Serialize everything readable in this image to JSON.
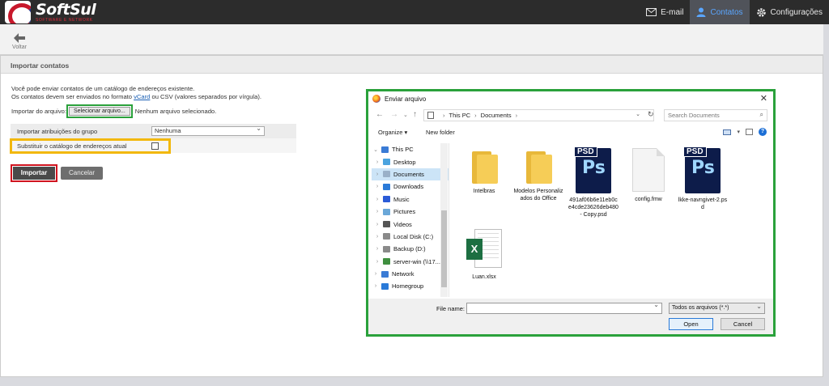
{
  "brand": {
    "name": "SoftSul",
    "tagline": "SOFTWARE E NETWORK"
  },
  "nav": {
    "items": [
      {
        "label": "E-mail",
        "icon": "envelope-icon"
      },
      {
        "label": "Contatos",
        "icon": "user-icon",
        "active": true
      },
      {
        "label": "Configurações",
        "icon": "gear-icon"
      }
    ]
  },
  "toolbar": {
    "back_label": "Voltar"
  },
  "panel": {
    "title": "Importar contatos",
    "intro_line1": "Você pode enviar contatos de um catálogo de endereços existente.",
    "intro_line2_prefix": "Os contatos devem ser enviados no formato ",
    "intro_link_vcard": "vCard",
    "intro_line2_suffix": " ou CSV (valores separados por vírgula).",
    "file_label": "Importar do arquivo:",
    "file_button": "Selecionar arquivo...",
    "file_status": "Nenhum arquivo selecionado.",
    "group_label": "Importar atribuições do grupo",
    "group_value": "Nenhuma",
    "replace_label": "Substituir o catálogo de endereços atual",
    "import_button": "Importar",
    "cancel_button": "Cancelar"
  },
  "dialog": {
    "title": "Enviar arquivo",
    "breadcrumb": [
      "This PC",
      "Documents"
    ],
    "search_placeholder": "Search Documents",
    "organize": "Organize ▾",
    "new_folder": "New folder",
    "tree": [
      {
        "label": "This PC",
        "icon": "computer-icon",
        "color": "#3a7bd5",
        "chev": "⌄",
        "indent": 0
      },
      {
        "label": "Desktop",
        "icon": "desktop-icon",
        "color": "#4aa3df",
        "chev": "›",
        "indent": 1
      },
      {
        "label": "Documents",
        "icon": "documents-icon",
        "color": "#9ab0c8",
        "chev": "›",
        "indent": 1,
        "selected": true
      },
      {
        "label": "Downloads",
        "icon": "download-icon",
        "color": "#2a7ad8",
        "chev": "›",
        "indent": 1
      },
      {
        "label": "Music",
        "icon": "music-icon",
        "color": "#2a5bd7",
        "chev": "›",
        "indent": 1
      },
      {
        "label": "Pictures",
        "icon": "pictures-icon",
        "color": "#6aa7d8",
        "chev": "›",
        "indent": 1
      },
      {
        "label": "Videos",
        "icon": "videos-icon",
        "color": "#555555",
        "chev": "›",
        "indent": 1
      },
      {
        "label": "Local Disk (C:)",
        "icon": "disk-icon",
        "color": "#8a8a8a",
        "chev": "›",
        "indent": 1
      },
      {
        "label": "Backup (D:)",
        "icon": "disk-icon",
        "color": "#8a8a8a",
        "chev": "›",
        "indent": 1
      },
      {
        "label": "server-win (\\\\17...",
        "icon": "network-drive-icon",
        "color": "#3f8f3f",
        "chev": "›",
        "indent": 1
      },
      {
        "label": "Network",
        "icon": "network-icon",
        "color": "#3a7bd5",
        "chev": "›",
        "indent": 0
      },
      {
        "label": "Homegroup",
        "icon": "homegroup-icon",
        "color": "#2a7ad8",
        "chev": "›",
        "indent": 0
      }
    ],
    "files": [
      {
        "name": "Intelbras",
        "kind": "folder"
      },
      {
        "name": "Modelos Personalizados do Office",
        "kind": "folder"
      },
      {
        "name": "491af06b6e11eb0ce4cde23626deb480 - Copy.psd",
        "kind": "psd"
      },
      {
        "name": "config.fmw",
        "kind": "doc"
      },
      {
        "name": "lkke-navngivet-2.psd",
        "kind": "psd"
      },
      {
        "name": "Luan.xlsx",
        "kind": "xlsx"
      }
    ],
    "file_name_label": "File name:",
    "file_type": "Todos os arquivos (*.*)",
    "open_button": "Open",
    "cancel_button": "Cancel"
  }
}
